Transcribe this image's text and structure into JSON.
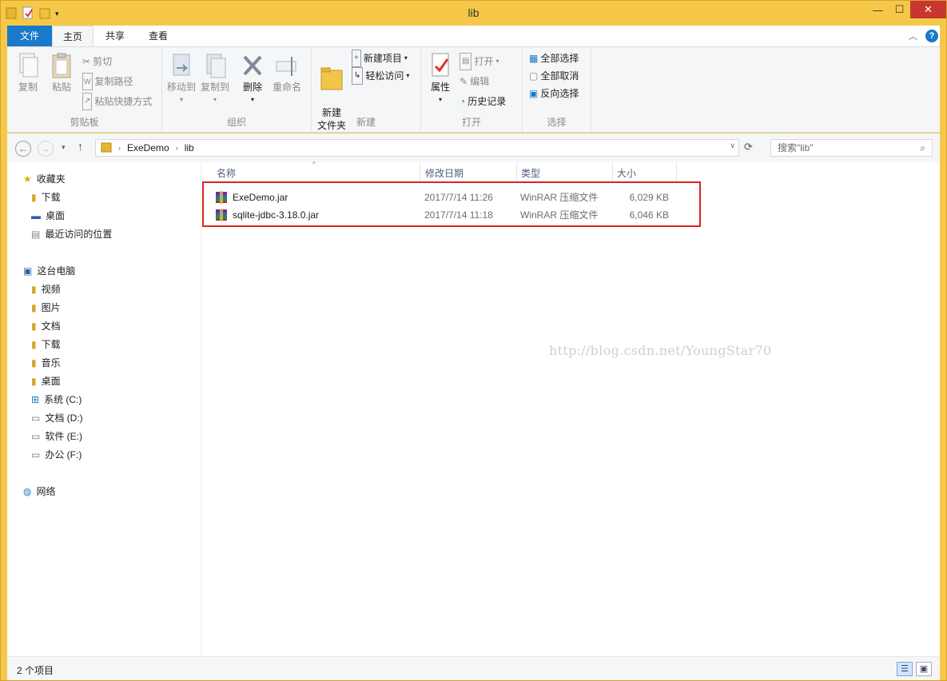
{
  "window": {
    "title": "lib"
  },
  "tabs": {
    "file": "文件",
    "home": "主页",
    "share": "共享",
    "view": "查看"
  },
  "ribbon": {
    "clipboard": {
      "label": "剪贴板",
      "copy": "复制",
      "paste": "粘贴",
      "cut": "剪切",
      "copy_path": "复制路径",
      "paste_shortcut": "粘贴快捷方式"
    },
    "organize": {
      "label": "组织",
      "move_to": "移动到",
      "copy_to": "复制到",
      "delete": "删除",
      "rename": "重命名"
    },
    "new": {
      "label": "新建",
      "new_folder": "新建\n文件夹",
      "new_item": "新建项目",
      "easy_access": "轻松访问"
    },
    "open": {
      "label": "打开",
      "properties": "属性",
      "open": "打开",
      "edit": "编辑",
      "history": "历史记录"
    },
    "select": {
      "label": "选择",
      "select_all": "全部选择",
      "select_none": "全部取消",
      "invert": "反向选择"
    }
  },
  "address": {
    "crumbs": [
      "ExeDemo",
      "lib"
    ],
    "search_placeholder": "搜索\"lib\""
  },
  "nav": {
    "favorites": {
      "label": "收藏夹",
      "items": [
        "下载",
        "桌面",
        "最近访问的位置"
      ]
    },
    "pc": {
      "label": "这台电脑",
      "items": [
        "视频",
        "图片",
        "文档",
        "下载",
        "音乐",
        "桌面",
        "系统 (C:)",
        "文档 (D:)",
        "软件 (E:)",
        "办公 (F:)"
      ]
    },
    "network": {
      "label": "网络"
    }
  },
  "columns": {
    "name": "名称",
    "date": "修改日期",
    "type": "类型",
    "size": "大小"
  },
  "files": [
    {
      "name": "ExeDemo.jar",
      "date": "2017/7/14 11:26",
      "type": "WinRAR 压缩文件",
      "size": "6,029 KB"
    },
    {
      "name": "sqlite-jdbc-3.18.0.jar",
      "date": "2017/7/14 11:18",
      "type": "WinRAR 压缩文件",
      "size": "6,046 KB"
    }
  ],
  "watermark": "http://blog.csdn.net/YoungStar70",
  "status": {
    "count": "2 个项目"
  },
  "colors": {
    "accent": "#1979ca",
    "highlight": "#e02020",
    "frame": "#f5c84a"
  }
}
